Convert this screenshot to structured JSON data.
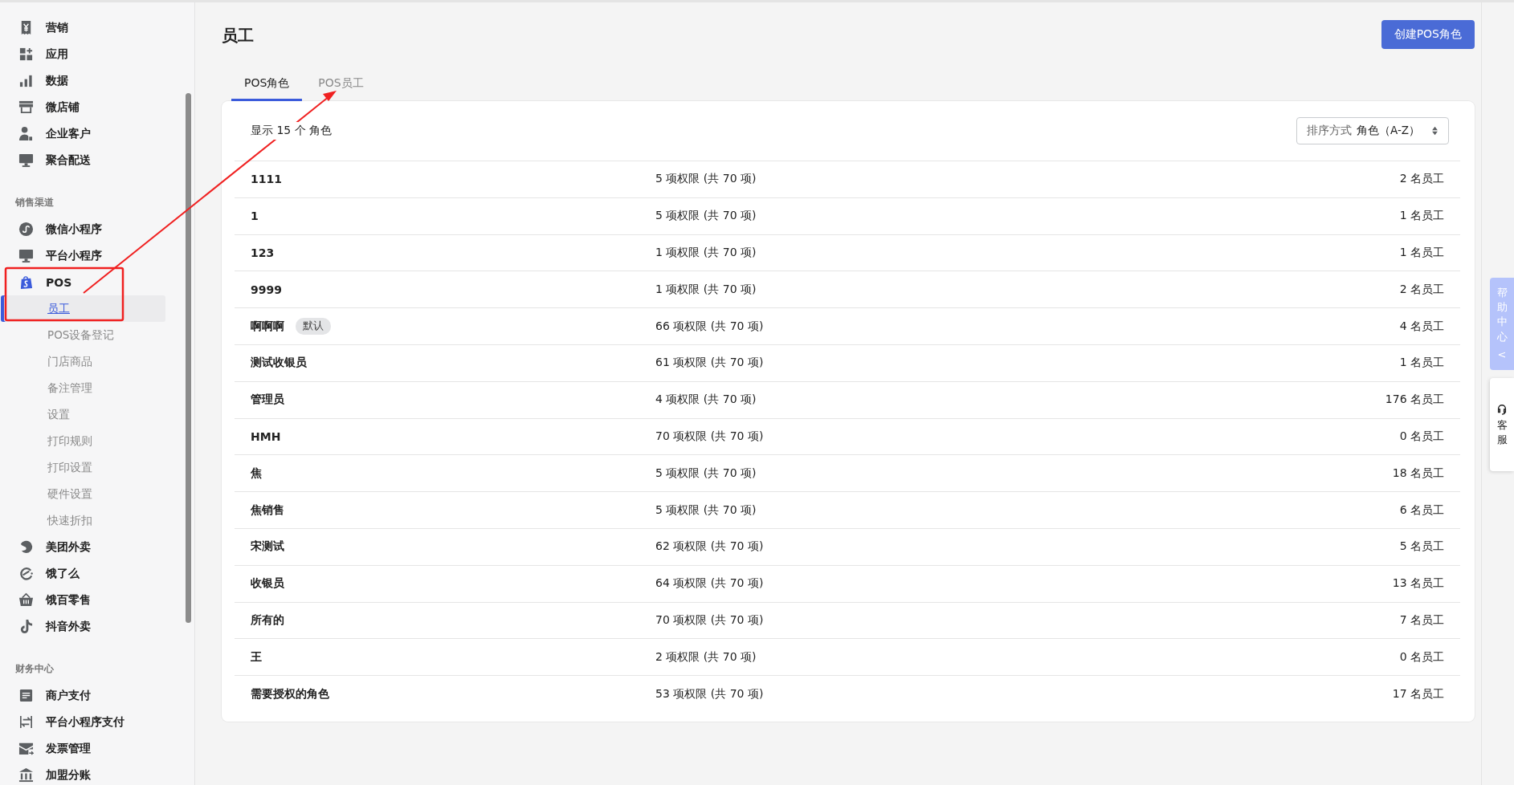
{
  "sidebar": {
    "groups": [
      {
        "items": [
          {
            "label": "营销",
            "selected": false
          },
          {
            "label": "应用",
            "selected": false
          },
          {
            "label": "数据",
            "selected": false
          },
          {
            "label": "微店铺",
            "selected": false
          },
          {
            "label": "企业客户",
            "selected": false
          },
          {
            "label": "聚合配送",
            "selected": false
          }
        ]
      },
      {
        "title": "销售渠道",
        "items": [
          {
            "label": "微信小程序",
            "selected": false
          },
          {
            "label": "平台小程序",
            "selected": false
          },
          {
            "label": "POS",
            "selected": true,
            "expanded": true,
            "children": [
              {
                "label": "员工",
                "selected": true
              },
              {
                "label": "POS设备登记",
                "selected": false
              },
              {
                "label": "门店商品",
                "selected": false
              },
              {
                "label": "备注管理",
                "selected": false
              },
              {
                "label": "设置",
                "selected": false
              },
              {
                "label": "打印规则",
                "selected": false
              },
              {
                "label": "打印设置",
                "selected": false
              },
              {
                "label": "硬件设置",
                "selected": false
              },
              {
                "label": "快速折扣",
                "selected": false
              }
            ]
          },
          {
            "label": "美团外卖",
            "selected": false
          },
          {
            "label": "饿了么",
            "selected": false
          },
          {
            "label": "饿百零售",
            "selected": false
          },
          {
            "label": "抖音外卖",
            "selected": false
          }
        ]
      },
      {
        "title": "财务中心",
        "items": [
          {
            "label": "商户支付",
            "selected": false
          },
          {
            "label": "平台小程序支付",
            "selected": false
          },
          {
            "label": "发票管理",
            "selected": false
          },
          {
            "label": "加盟分账",
            "selected": false
          }
        ]
      }
    ]
  },
  "page": {
    "title": "员工",
    "create_button": "创建POS角色"
  },
  "tabs": [
    {
      "label": "POS角色",
      "selected": true
    },
    {
      "label": "POS员工",
      "selected": false
    }
  ],
  "table": {
    "summary": "显示 15 个 角色",
    "sort": {
      "label": "排序方式",
      "value": "角色（A-Z）"
    },
    "rows": [
      {
        "name": "1111",
        "permissions": "5 项权限 (共 70 项)",
        "employees": "2 名员工"
      },
      {
        "name": "1",
        "permissions": "5 项权限 (共 70 项)",
        "employees": "1 名员工"
      },
      {
        "name": "123",
        "permissions": "1 项权限 (共 70 项)",
        "employees": "1 名员工"
      },
      {
        "name": "9999",
        "permissions": "1 项权限 (共 70 项)",
        "employees": "2 名员工"
      },
      {
        "name": "啊啊啊",
        "badge": "默认",
        "permissions": "66 项权限 (共 70 项)",
        "employees": "4 名员工"
      },
      {
        "name": "测试收银员",
        "permissions": "61 项权限 (共 70 项)",
        "employees": "1 名员工"
      },
      {
        "name": "管理员",
        "permissions": "4 项权限 (共 70 项)",
        "employees": "176 名员工"
      },
      {
        "name": "HMH",
        "permissions": "70 项权限 (共 70 项)",
        "employees": "0 名员工"
      },
      {
        "name": "焦",
        "permissions": "5 项权限 (共 70 项)",
        "employees": "18 名员工"
      },
      {
        "name": "焦销售",
        "permissions": "5 项权限 (共 70 项)",
        "employees": "6 名员工"
      },
      {
        "name": "宋测试",
        "permissions": "62 项权限 (共 70 项)",
        "employees": "5 名员工"
      },
      {
        "name": "收银员",
        "permissions": "64 项权限 (共 70 项)",
        "employees": "13 名员工"
      },
      {
        "name": "所有的",
        "permissions": "70 项权限 (共 70 项)",
        "employees": "7 名员工"
      },
      {
        "name": "王",
        "permissions": "2 项权限 (共 70 项)",
        "employees": "0 名员工"
      },
      {
        "name": "需要授权的角色",
        "permissions": "53 项权限 (共 70 项)",
        "employees": "17 名员工"
      }
    ]
  },
  "help_panel": {
    "label": "帮助中心",
    "toggle": "<"
  },
  "service": {
    "label": "客服"
  }
}
